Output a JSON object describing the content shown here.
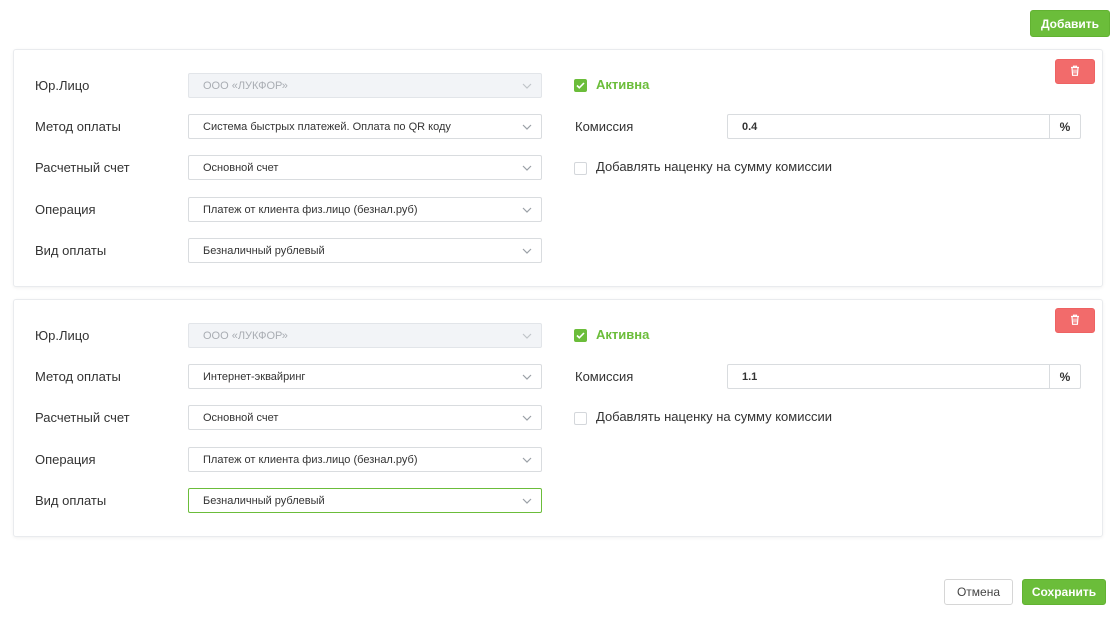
{
  "header": {
    "add_label": "Добавить"
  },
  "labels": {
    "legal_entity": "Юр.Лицо",
    "payment_method": "Метод оплаты",
    "account": "Расчетный счет",
    "operation": "Операция",
    "payment_type": "Вид оплаты",
    "active": "Активна",
    "commission": "Комиссия",
    "markup": "Добавлять наценку на сумму комиссии",
    "percent": "%"
  },
  "cards": [
    {
      "legal_entity": "ООО «ЛУКФОР»",
      "payment_method": "Система быстрых платежей. Оплата по QR коду",
      "account": "Основной счет",
      "operation": "Платеж от клиента физ.лицо (безнал.руб)",
      "payment_type": "Безналичный рублевый",
      "active": true,
      "commission": "0.4",
      "markup": false
    },
    {
      "legal_entity": "ООО «ЛУКФОР»",
      "payment_method": "Интернет-эквайринг",
      "account": "Основной счет",
      "operation": "Платеж от клиента физ.лицо (безнал.руб)",
      "payment_type": "Безналичный рублевый",
      "active": true,
      "commission": "1.1",
      "markup": false
    }
  ],
  "footer": {
    "cancel_label": "Отмена",
    "save_label": "Сохранить"
  },
  "colors": {
    "accent": "#6bbd3a",
    "danger": "#f26b6b",
    "border": "#d9dcdf"
  },
  "icons": {
    "select_arrow": "chevron-down-icon",
    "delete": "trash-icon",
    "checkbox": "checkmark-icon"
  }
}
